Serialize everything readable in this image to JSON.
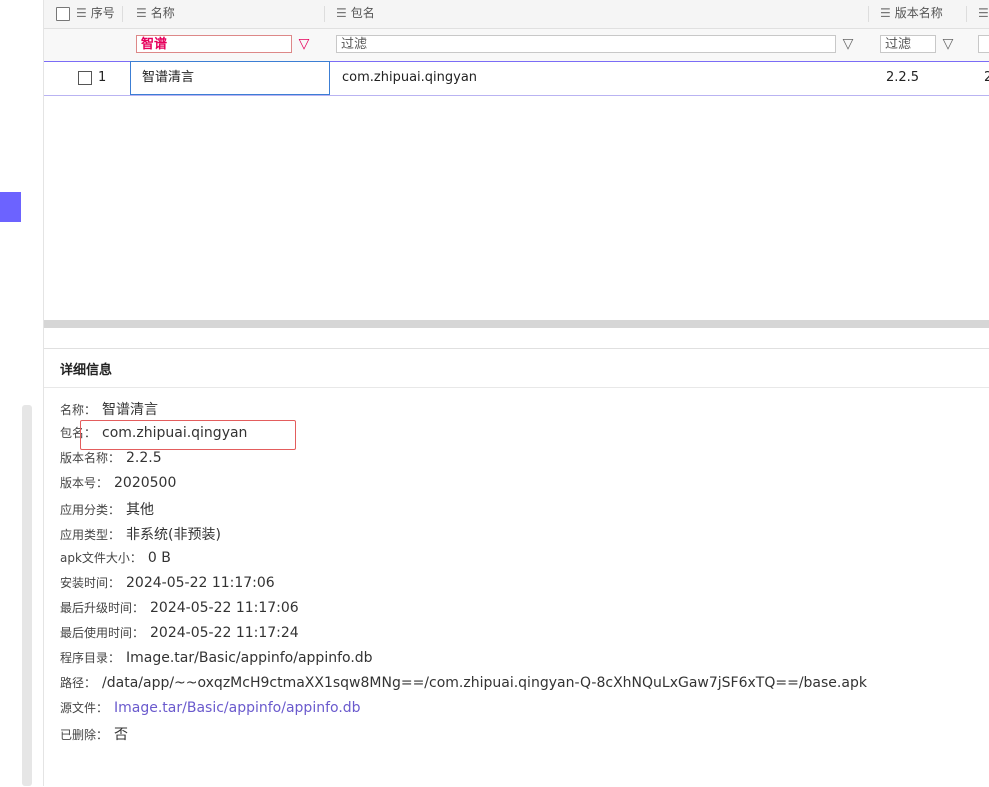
{
  "table": {
    "columns": {
      "index": "序号",
      "name": "名称",
      "package": "包名",
      "version_name": "版本名称"
    },
    "filters": {
      "name_value": "智谱",
      "package_placeholder": "过滤",
      "version_placeholder": "过滤"
    },
    "rows": [
      {
        "index": "1",
        "name": "智谱清言",
        "package": "com.zhipuai.qingyan",
        "version_name": "2.2.5",
        "extra": "2"
      }
    ]
  },
  "detail": {
    "title": "详细信息",
    "fields": [
      {
        "label": "名称：",
        "value": "智谱清言"
      },
      {
        "label": "包名：",
        "value": "com.zhipuai.qingyan"
      },
      {
        "label": "版本名称：",
        "value": "2.2.5"
      },
      {
        "label": "版本号：",
        "value": "2020500"
      },
      {
        "label": "应用分类：",
        "value": "其他"
      },
      {
        "label": "应用类型：",
        "value": "非系统(非预装)"
      },
      {
        "label": "apk文件大小：",
        "value": "0 B"
      },
      {
        "label": "安装时间：",
        "value": "2024-05-22 11:17:06"
      },
      {
        "label": "最后升级时间：",
        "value": "2024-05-22 11:17:06"
      },
      {
        "label": "最后使用时间：",
        "value": "2024-05-22 11:17:24"
      },
      {
        "label": "程序目录：",
        "value": "Image.tar/Basic/appinfo/appinfo.db"
      },
      {
        "label": "路径：",
        "value": "/data/app/~~oxqzMcH9ctmaXX1sqw8MNg==/com.zhipuai.qingyan-Q-8cXhNQuLxGaw7jSF6xTQ==/base.apk"
      },
      {
        "label": "源文件：",
        "value": "Image.tar/Basic/appinfo/appinfo.db"
      },
      {
        "label": "已删除：",
        "value": "否"
      }
    ]
  },
  "colors": {
    "accent": "#6c63ff",
    "filter_active": "#e6005c",
    "link": "#6a5acd",
    "highlight_box": "#e35d5d"
  }
}
